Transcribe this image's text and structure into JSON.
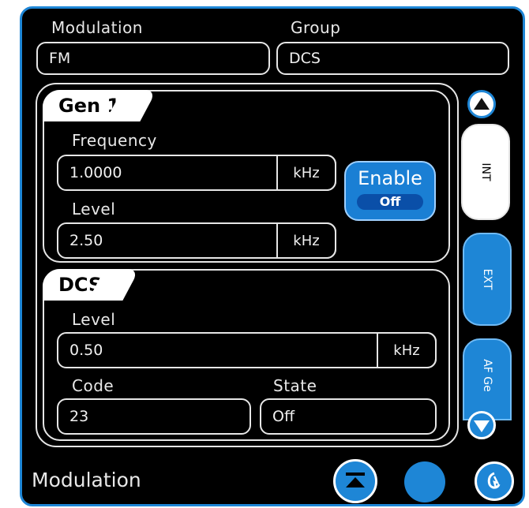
{
  "header": {
    "modulation_label": "Modulation",
    "modulation_value": "FM",
    "group_label": "Group",
    "group_value": "DCS"
  },
  "gen1": {
    "title": "Gen 1",
    "frequency_label": "Frequency",
    "frequency_value": "1.0000",
    "frequency_unit": "kHz",
    "level_label": "Level",
    "level_value": "2.50",
    "level_unit": "kHz",
    "enable_label": "Enable",
    "enable_state": "Off"
  },
  "dcs": {
    "title": "DCS",
    "level_label": "Level",
    "level_value": "0.50",
    "level_unit": "kHz",
    "code_label": "Code",
    "code_value": "23",
    "state_label": "State",
    "state_value": "Off"
  },
  "side_tabs": [
    "INT",
    "EXT",
    "AF Ge"
  ],
  "footer": {
    "title": "Modulation"
  },
  "colors": {
    "accent": "#1e86d6",
    "background": "#000000",
    "outline": "#e6e6e6"
  }
}
